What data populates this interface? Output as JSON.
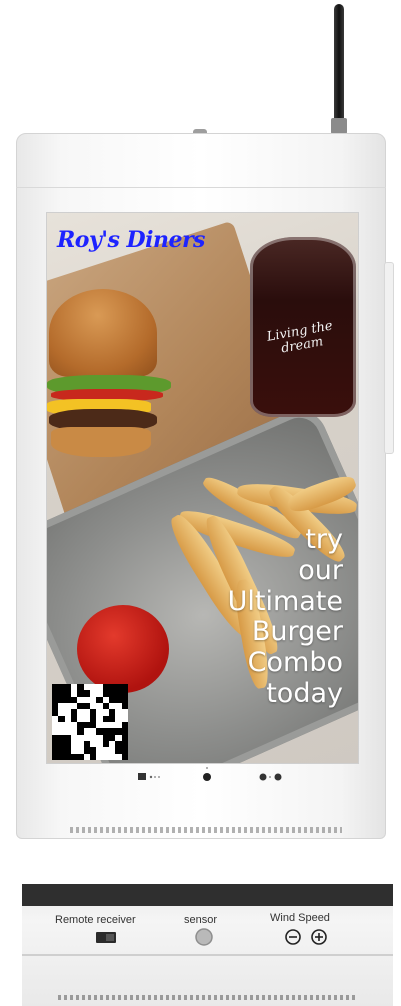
{
  "screen": {
    "brand": "Roy's Diners",
    "promo_lines": [
      "try",
      "our",
      "Ultimate",
      "Burger",
      "Combo",
      "today"
    ],
    "glass_text": "Living the dream"
  },
  "panel_labels": {
    "remote_receiver": "Remote receiver",
    "sensor": "sensor",
    "wind_speed": "Wind Speed"
  },
  "colors": {
    "brand_text": "#1d23ff",
    "promo_text": "#ffffff",
    "cabinet": "#f4f4f4"
  },
  "icons": [
    "antenna-icon",
    "qr-code-icon",
    "remote-receiver-icon",
    "sensor-icon",
    "minus-icon",
    "plus-icon"
  ]
}
